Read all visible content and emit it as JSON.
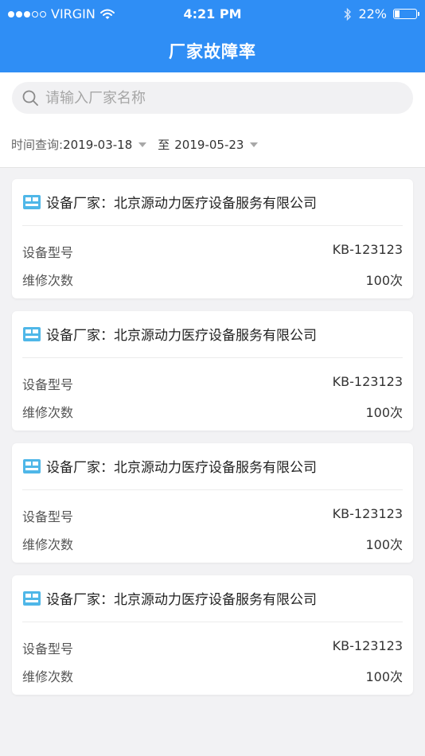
{
  "status_bar": {
    "carrier": "VIRGIN",
    "time": "4:21 PM",
    "battery": "22%",
    "battery_level": 0.22
  },
  "nav": {
    "title": "厂家故障率"
  },
  "search": {
    "placeholder": "请输入厂家名称",
    "value": ""
  },
  "date_filter": {
    "label": "时间查询:",
    "start": "2019-03-18",
    "separator": "至",
    "end": "2019-05-23"
  },
  "cards": [
    {
      "manufacturer_label": "设备厂家：北京源动力医疗设备服务有限公司",
      "model_label": "设备型号",
      "model_value": "KB-123123",
      "repair_label": "维修次数",
      "repair_value": "100次"
    },
    {
      "manufacturer_label": "设备厂家：北京源动力医疗设备服务有限公司",
      "model_label": "设备型号",
      "model_value": "KB-123123",
      "repair_label": "维修次数",
      "repair_value": "100次"
    },
    {
      "manufacturer_label": "设备厂家：北京源动力医疗设备服务有限公司",
      "model_label": "设备型号",
      "model_value": "KB-123123",
      "repair_label": "维修次数",
      "repair_value": "100次"
    },
    {
      "manufacturer_label": "设备厂家：北京源动力医疗设备服务有限公司",
      "model_label": "设备型号",
      "model_value": "KB-123123",
      "repair_label": "维修次数",
      "repair_value": "100次"
    }
  ],
  "colors": {
    "primary": "#2f8ef5",
    "background": "#f2f2f4",
    "icon_accent": "#4fb7e8"
  },
  "icons": {
    "search": "search-icon",
    "device": "device-icon"
  }
}
